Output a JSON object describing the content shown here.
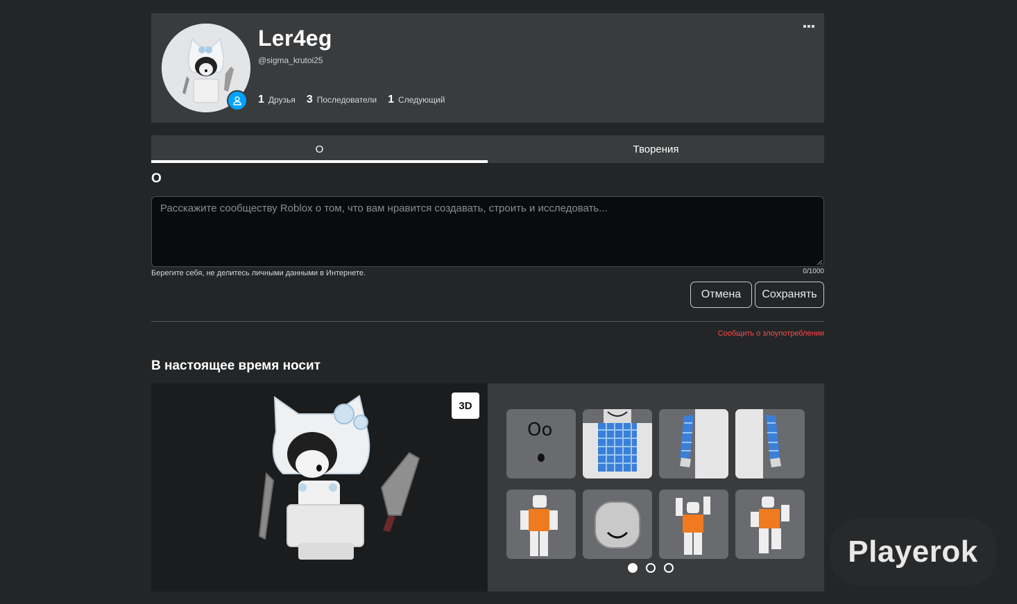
{
  "profile": {
    "display_name": "Ler4eg",
    "username": "@sigma_krutoi25",
    "stats": [
      {
        "count": "1",
        "label": "Друзья"
      },
      {
        "count": "3",
        "label": "Последователи"
      },
      {
        "count": "1",
        "label": "Следующий"
      }
    ]
  },
  "tabs": [
    {
      "label": "О",
      "active": true
    },
    {
      "label": "Творения",
      "active": false
    }
  ],
  "about": {
    "title": "О",
    "placeholder": "Расскажите сообществу Roblox о том, что вам нравится создавать, строить и исследовать...",
    "value": "",
    "safety_note": "Берегите себя, не делитесь личными данными в Интернете.",
    "char_count": "0/1000",
    "cancel_label": "Отмена",
    "save_label": "Сохранять",
    "report_label": "Сообщить о злоупотреблении"
  },
  "wearing": {
    "title": "В настоящее время носит",
    "view_toggle_label": "3D",
    "items": [
      "face-item",
      "shirt-item",
      "left-arm-item",
      "right-arm-item",
      "idle-animation-item",
      "head-item",
      "climb-animation-item",
      "run-animation-item"
    ],
    "pages": 3,
    "current_page": 1
  },
  "watermark": "Playerok",
  "colors": {
    "background": "#232527",
    "card": "#393b3d",
    "accent_blue": "#00a2ff",
    "report_red": "#ff4a4a"
  }
}
